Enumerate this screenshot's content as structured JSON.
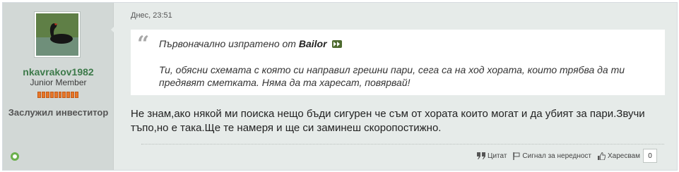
{
  "user": {
    "name": "nkavrakov1982",
    "title": "Junior Member",
    "rank": "Заслужил инвеститор",
    "reputation_segments": 10,
    "status_color": "#6ab04c"
  },
  "post": {
    "date": "Днес, 23:51",
    "quote": {
      "prefix": "Първоначално изпратено от",
      "author": "Bailor",
      "text": "Ти, обясни схемата с която си направил грешни пари, сега са на ход хората, които трябва да ти предявят сметката. Няма да та харесат, повярвай!"
    },
    "message": "Не знам,ако някой ми поиска нещо бъди сигурен че съм от хората които могат и да убият за пари.Звучи тъпо,но е така.Ще те намеря и ще си заминеш скоропостижно."
  },
  "actions": {
    "quote_label": "Цитат",
    "report_label": "Сигнал за нередност",
    "like_label": "Харесвам",
    "like_count": "0"
  },
  "icons": {
    "quote": "quote-icon",
    "goto": "goto-post-icon",
    "report": "flag-icon",
    "like": "thumbs-up-icon",
    "online": "online-status-icon"
  }
}
